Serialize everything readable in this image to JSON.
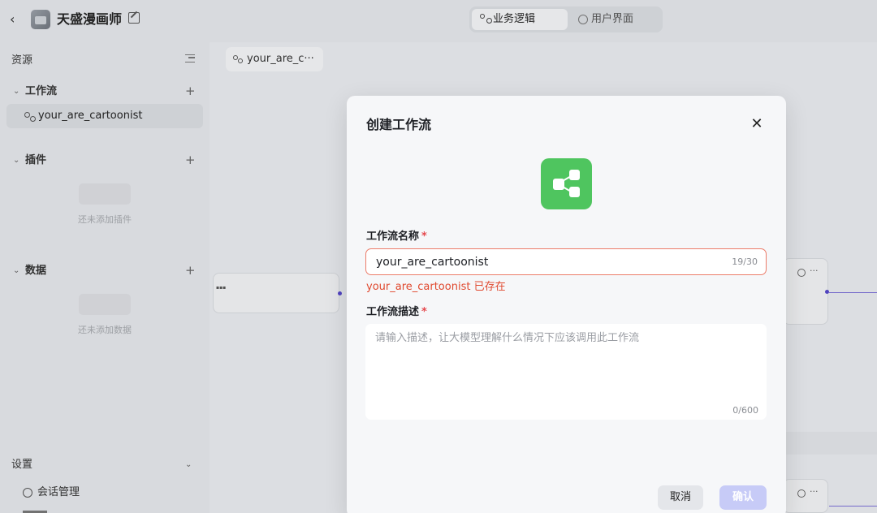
{
  "header": {
    "app_title": "天盛漫画师",
    "tabs": [
      {
        "label": "业务逻辑",
        "active": true
      },
      {
        "label": "用户界面",
        "active": false
      }
    ]
  },
  "sidebar": {
    "title": "资源",
    "groups": {
      "workflow": {
        "label": "工作流",
        "items": [
          "your_are_cartoonist"
        ]
      },
      "plugin": {
        "label": "插件",
        "empty": "还未添加插件"
      },
      "data": {
        "label": "数据",
        "empty": "还未添加数据"
      }
    },
    "settings": {
      "label": "设置",
      "items": [
        "会话管理"
      ]
    }
  },
  "canvas": {
    "tab_label": "your_are_c···"
  },
  "modal": {
    "title": "创建工作流",
    "name_label": "工作流名称",
    "name_value": "your_are_cartoonist",
    "name_count": "19/30",
    "name_error": "your_are_cartoonist 已存在",
    "desc_label": "工作流描述",
    "desc_placeholder": "请输入描述，让大模型理解什么情况下应该调用此工作流",
    "desc_count": "0/600",
    "required_mark": "*",
    "cancel_label": "取消",
    "confirm_label": "确认"
  },
  "colors": {
    "accent": "#4fc55f",
    "error": "#e0492f",
    "confirm_disabled": "#c7cbf7",
    "edge": "#7b6fd6"
  }
}
